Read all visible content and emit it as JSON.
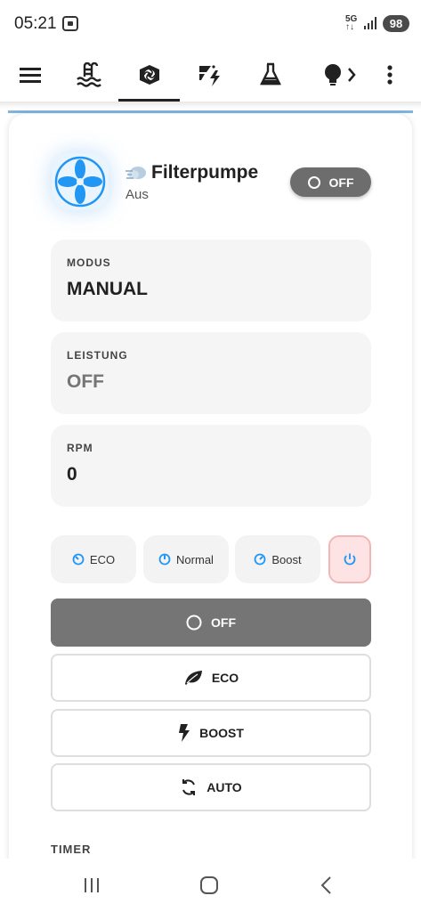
{
  "status_bar": {
    "time": "05:21",
    "network": "5G",
    "battery": "98"
  },
  "nav": {
    "active_index": 2,
    "tabs": [
      {
        "icon": "menu-icon"
      },
      {
        "icon": "pool-icon"
      },
      {
        "icon": "pump-icon"
      },
      {
        "icon": "sun-lightning-icon"
      },
      {
        "icon": "flask-icon"
      },
      {
        "icon": "lightbulb-icon"
      }
    ]
  },
  "device": {
    "name": "Filterpumpe",
    "state": "Aus",
    "toggle_label": "OFF",
    "icon": "fan-icon"
  },
  "stats": [
    {
      "label": "MODUS",
      "value": "MANUAL"
    },
    {
      "label": "LEISTUNG",
      "value": "OFF"
    },
    {
      "label": "RPM",
      "value": "0"
    }
  ],
  "modes": [
    {
      "label": "ECO",
      "icon": "gauge-low-icon"
    },
    {
      "label": "Normal",
      "icon": "gauge-mid-icon"
    },
    {
      "label": "Boost",
      "icon": "gauge-high-icon"
    }
  ],
  "actions": [
    {
      "label": "OFF",
      "icon": "circle-icon",
      "active": true
    },
    {
      "label": "ECO",
      "icon": "leaf-icon"
    },
    {
      "label": "BOOST",
      "icon": "lightning-icon"
    },
    {
      "label": "AUTO",
      "icon": "refresh-icon"
    }
  ],
  "timer_label": "TIMER",
  "colors": {
    "accent": "#2196f3",
    "toggle_off": "#6d6d6d",
    "power_bg": "#fde3e3",
    "blue_line": "#7fb6de"
  }
}
